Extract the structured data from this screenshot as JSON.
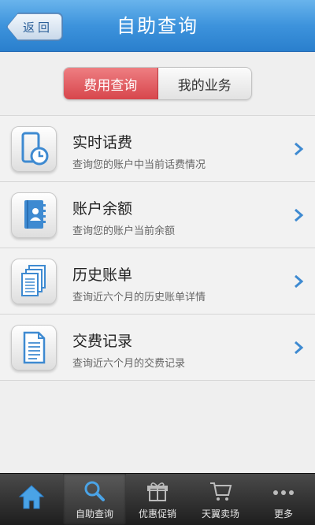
{
  "header": {
    "back_label": "返回",
    "title": "自助查询"
  },
  "segment": {
    "tabs": [
      {
        "label": "费用查询",
        "active": true
      },
      {
        "label": "我的业务",
        "active": false
      }
    ]
  },
  "list": {
    "items": [
      {
        "title": "实时话费",
        "subtitle": "查询您的账户中当前话费情况",
        "icon": "phone-clock-icon"
      },
      {
        "title": "账户余额",
        "subtitle": "查询您的账户当前余额",
        "icon": "contact-book-icon"
      },
      {
        "title": "历史账单",
        "subtitle": "查询近六个月的历史账单详情",
        "icon": "documents-stack-icon"
      },
      {
        "title": "交费记录",
        "subtitle": "查询近六个月的交费记录",
        "icon": "document-icon"
      }
    ]
  },
  "tabbar": {
    "tabs": [
      {
        "label": "",
        "icon": "home-icon"
      },
      {
        "label": "自助查询",
        "icon": "search-icon",
        "active": true
      },
      {
        "label": "优惠促销",
        "icon": "gift-icon"
      },
      {
        "label": "天翼卖场",
        "icon": "cart-icon"
      },
      {
        "label": "更多",
        "icon": "more-icon"
      }
    ]
  },
  "colors": {
    "header_blue": "#3d93dc",
    "segment_active_red": "#d7464c",
    "icon_blue": "#3e8ad1"
  }
}
